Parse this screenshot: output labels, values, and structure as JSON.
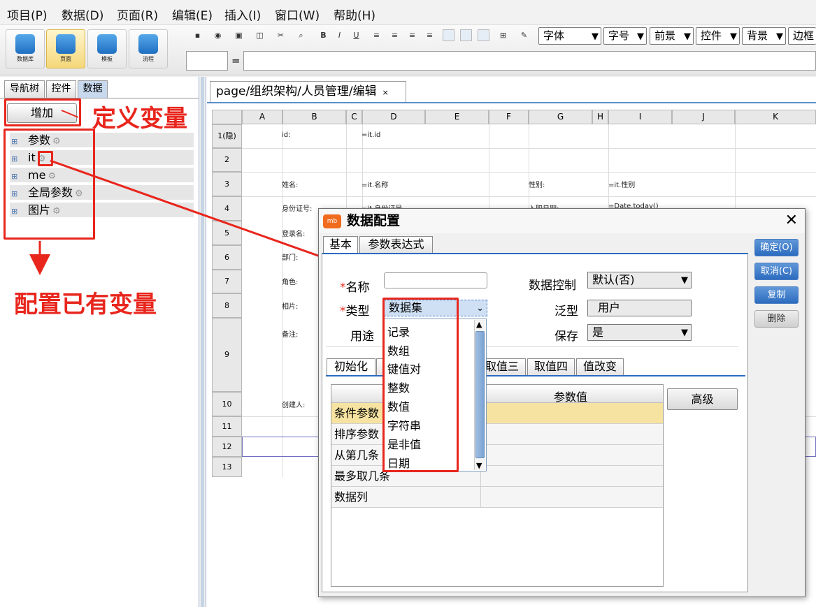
{
  "menu": [
    "项目(P)",
    "数据(D)",
    "页面(R)",
    "编辑(E)",
    "插入(I)",
    "窗口(W)",
    "帮助(H)"
  ],
  "toolbar": {
    "big_buttons": [
      {
        "label": "数据库",
        "icon": "database-icon"
      },
      {
        "label": "页面",
        "icon": "page-icon"
      },
      {
        "label": "模板",
        "icon": "template-icon"
      },
      {
        "label": "流程",
        "icon": "flow-icon"
      }
    ],
    "format_buttons": [
      "B",
      "I",
      "U"
    ],
    "selects": [
      "字体",
      "字号",
      "前景",
      "控件",
      "背景",
      "边框"
    ],
    "formula_eq": "="
  },
  "left": {
    "tabs": [
      "导航树",
      "控件",
      "数据"
    ],
    "add_label": "增加",
    "tree": [
      "参数",
      "it",
      "me",
      "全局参数",
      "图片"
    ],
    "annot_define": "定义变量",
    "annot_config": "配置已有变量"
  },
  "editor": {
    "tab_label": "page/组织架构/人员管理/编辑",
    "tab_close": "×",
    "columns": [
      "A",
      "B",
      "C",
      "D",
      "E",
      "F",
      "G",
      "H",
      "I",
      "J",
      "K"
    ],
    "rows": [
      "1(隐)",
      "2",
      "3",
      "4",
      "5",
      "6",
      "7",
      "8",
      "9",
      "10",
      "11",
      "12",
      "13"
    ],
    "cells": {
      "r1_b": "id:",
      "r1_d": "=it.id",
      "r3_b": "姓名:",
      "r3_d": "=it.名称",
      "r3_g": "性别:",
      "r3_i": "=it.性别",
      "r4_b": "身份证号:",
      "r4_d": "=it.身份证号",
      "r4_g": "入职日期:",
      "r4_i": "=Date.today()",
      "r5_b": "登录名:",
      "r6_b": "部门:",
      "r7_b": "角色:",
      "r8_b": "相片:",
      "r9_b": "备注:",
      "r10_b": "创建人:"
    }
  },
  "dialog": {
    "title": "数据配置",
    "logo": "mb",
    "close": "✕",
    "tabs": [
      "基本",
      "参数表达式"
    ],
    "buttons": [
      "确定(O)",
      "取消(C)",
      "复制",
      "删除"
    ],
    "name_label": "名称",
    "type_label": "类型",
    "usage_label": "用途",
    "type_value": "数据集",
    "control_label": "数据控制",
    "control_value": "默认(否)",
    "generic_label": "泛型",
    "generic_value": "用户",
    "save_label": "保存",
    "save_value": "是",
    "subtabs": [
      "初始化",
      "取值三",
      "取值四",
      "值改变"
    ],
    "grid_header": "参数值",
    "grid_rows": [
      "条件参数",
      "排序参数",
      "从第几条",
      "最多取几条",
      "数据列"
    ],
    "advanced": "高级",
    "dropdown": [
      "记录",
      "数组",
      "键值对",
      "整数",
      "数值",
      "字符串",
      "是非值",
      "日期"
    ]
  },
  "colors": {
    "accent": "#2c6bbf",
    "annotation": "#e8261d",
    "highlight": "#f6e3a1"
  }
}
